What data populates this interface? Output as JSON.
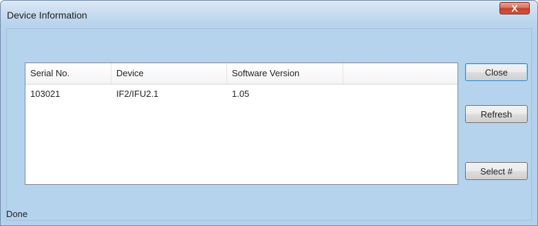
{
  "window": {
    "title": "Device Information",
    "close_glyph": "X"
  },
  "list": {
    "columns": [
      "Serial No.",
      "Device",
      "Software Version",
      ""
    ],
    "rows": [
      [
        "103021",
        "IF2/IFU2.1",
        "1.05",
        ""
      ]
    ]
  },
  "buttons": {
    "close": "Close",
    "refresh": "Refresh",
    "select": "Select #"
  },
  "status": "Done",
  "colors": {
    "client_bg": "#b6d3ee",
    "close_button": "#c4412c"
  }
}
